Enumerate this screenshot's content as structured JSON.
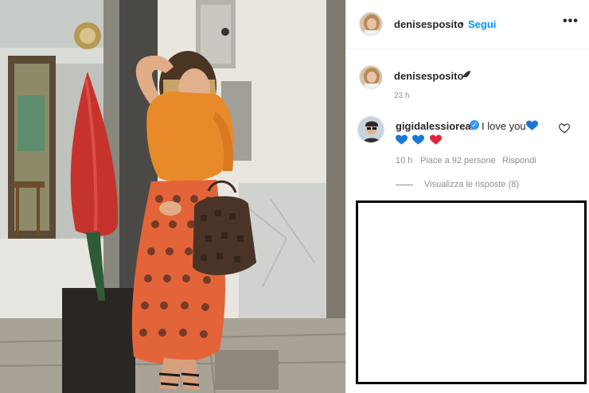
{
  "post": {
    "username": "denisesposito",
    "follow_label": "Segui",
    "more_label": "•••",
    "caption": {
      "username": "denisesposito",
      "emoji_icon": "rocket-icon",
      "time": "23 h"
    },
    "comment": {
      "username": "gigidalessioreal",
      "verified_icon": "verified-badge-icon",
      "text": "I love you",
      "hearts": [
        "blue",
        "blue",
        "red"
      ],
      "time": "10 h",
      "likes": "Piace a 92 persone",
      "reply_label": "Rispondi"
    },
    "view_replies": "Visualizza le risposte (8)"
  },
  "colors": {
    "follow_blue": "#0095f6",
    "muted_gray": "#8e8e8e",
    "heart_blue": "#1a78d6",
    "heart_red": "#e0263a"
  }
}
